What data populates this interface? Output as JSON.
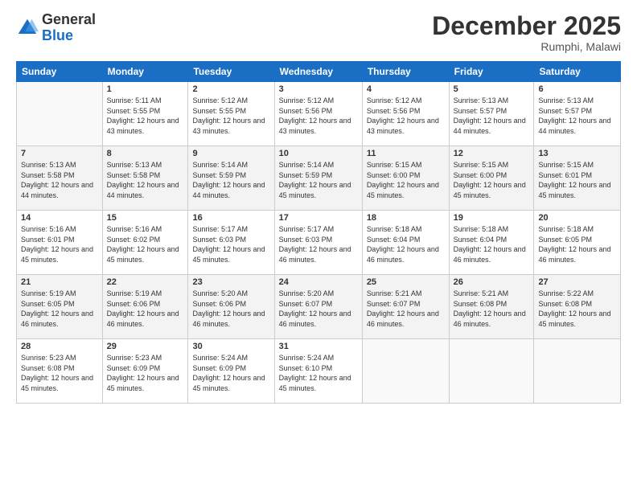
{
  "logo": {
    "general": "General",
    "blue": "Blue"
  },
  "header": {
    "month": "December 2025",
    "location": "Rumphi, Malawi"
  },
  "weekdays": [
    "Sunday",
    "Monday",
    "Tuesday",
    "Wednesday",
    "Thursday",
    "Friday",
    "Saturday"
  ],
  "weeks": [
    [
      {
        "day": "",
        "sunrise": "",
        "sunset": "",
        "daylight": ""
      },
      {
        "day": "1",
        "sunrise": "Sunrise: 5:11 AM",
        "sunset": "Sunset: 5:55 PM",
        "daylight": "Daylight: 12 hours and 43 minutes."
      },
      {
        "day": "2",
        "sunrise": "Sunrise: 5:12 AM",
        "sunset": "Sunset: 5:55 PM",
        "daylight": "Daylight: 12 hours and 43 minutes."
      },
      {
        "day": "3",
        "sunrise": "Sunrise: 5:12 AM",
        "sunset": "Sunset: 5:56 PM",
        "daylight": "Daylight: 12 hours and 43 minutes."
      },
      {
        "day": "4",
        "sunrise": "Sunrise: 5:12 AM",
        "sunset": "Sunset: 5:56 PM",
        "daylight": "Daylight: 12 hours and 43 minutes."
      },
      {
        "day": "5",
        "sunrise": "Sunrise: 5:13 AM",
        "sunset": "Sunset: 5:57 PM",
        "daylight": "Daylight: 12 hours and 44 minutes."
      },
      {
        "day": "6",
        "sunrise": "Sunrise: 5:13 AM",
        "sunset": "Sunset: 5:57 PM",
        "daylight": "Daylight: 12 hours and 44 minutes."
      }
    ],
    [
      {
        "day": "7",
        "sunrise": "Sunrise: 5:13 AM",
        "sunset": "Sunset: 5:58 PM",
        "daylight": "Daylight: 12 hours and 44 minutes."
      },
      {
        "day": "8",
        "sunrise": "Sunrise: 5:13 AM",
        "sunset": "Sunset: 5:58 PM",
        "daylight": "Daylight: 12 hours and 44 minutes."
      },
      {
        "day": "9",
        "sunrise": "Sunrise: 5:14 AM",
        "sunset": "Sunset: 5:59 PM",
        "daylight": "Daylight: 12 hours and 44 minutes."
      },
      {
        "day": "10",
        "sunrise": "Sunrise: 5:14 AM",
        "sunset": "Sunset: 5:59 PM",
        "daylight": "Daylight: 12 hours and 45 minutes."
      },
      {
        "day": "11",
        "sunrise": "Sunrise: 5:15 AM",
        "sunset": "Sunset: 6:00 PM",
        "daylight": "Daylight: 12 hours and 45 minutes."
      },
      {
        "day": "12",
        "sunrise": "Sunrise: 5:15 AM",
        "sunset": "Sunset: 6:00 PM",
        "daylight": "Daylight: 12 hours and 45 minutes."
      },
      {
        "day": "13",
        "sunrise": "Sunrise: 5:15 AM",
        "sunset": "Sunset: 6:01 PM",
        "daylight": "Daylight: 12 hours and 45 minutes."
      }
    ],
    [
      {
        "day": "14",
        "sunrise": "Sunrise: 5:16 AM",
        "sunset": "Sunset: 6:01 PM",
        "daylight": "Daylight: 12 hours and 45 minutes."
      },
      {
        "day": "15",
        "sunrise": "Sunrise: 5:16 AM",
        "sunset": "Sunset: 6:02 PM",
        "daylight": "Daylight: 12 hours and 45 minutes."
      },
      {
        "day": "16",
        "sunrise": "Sunrise: 5:17 AM",
        "sunset": "Sunset: 6:03 PM",
        "daylight": "Daylight: 12 hours and 45 minutes."
      },
      {
        "day": "17",
        "sunrise": "Sunrise: 5:17 AM",
        "sunset": "Sunset: 6:03 PM",
        "daylight": "Daylight: 12 hours and 46 minutes."
      },
      {
        "day": "18",
        "sunrise": "Sunrise: 5:18 AM",
        "sunset": "Sunset: 6:04 PM",
        "daylight": "Daylight: 12 hours and 46 minutes."
      },
      {
        "day": "19",
        "sunrise": "Sunrise: 5:18 AM",
        "sunset": "Sunset: 6:04 PM",
        "daylight": "Daylight: 12 hours and 46 minutes."
      },
      {
        "day": "20",
        "sunrise": "Sunrise: 5:18 AM",
        "sunset": "Sunset: 6:05 PM",
        "daylight": "Daylight: 12 hours and 46 minutes."
      }
    ],
    [
      {
        "day": "21",
        "sunrise": "Sunrise: 5:19 AM",
        "sunset": "Sunset: 6:05 PM",
        "daylight": "Daylight: 12 hours and 46 minutes."
      },
      {
        "day": "22",
        "sunrise": "Sunrise: 5:19 AM",
        "sunset": "Sunset: 6:06 PM",
        "daylight": "Daylight: 12 hours and 46 minutes."
      },
      {
        "day": "23",
        "sunrise": "Sunrise: 5:20 AM",
        "sunset": "Sunset: 6:06 PM",
        "daylight": "Daylight: 12 hours and 46 minutes."
      },
      {
        "day": "24",
        "sunrise": "Sunrise: 5:20 AM",
        "sunset": "Sunset: 6:07 PM",
        "daylight": "Daylight: 12 hours and 46 minutes."
      },
      {
        "day": "25",
        "sunrise": "Sunrise: 5:21 AM",
        "sunset": "Sunset: 6:07 PM",
        "daylight": "Daylight: 12 hours and 46 minutes."
      },
      {
        "day": "26",
        "sunrise": "Sunrise: 5:21 AM",
        "sunset": "Sunset: 6:08 PM",
        "daylight": "Daylight: 12 hours and 46 minutes."
      },
      {
        "day": "27",
        "sunrise": "Sunrise: 5:22 AM",
        "sunset": "Sunset: 6:08 PM",
        "daylight": "Daylight: 12 hours and 45 minutes."
      }
    ],
    [
      {
        "day": "28",
        "sunrise": "Sunrise: 5:23 AM",
        "sunset": "Sunset: 6:08 PM",
        "daylight": "Daylight: 12 hours and 45 minutes."
      },
      {
        "day": "29",
        "sunrise": "Sunrise: 5:23 AM",
        "sunset": "Sunset: 6:09 PM",
        "daylight": "Daylight: 12 hours and 45 minutes."
      },
      {
        "day": "30",
        "sunrise": "Sunrise: 5:24 AM",
        "sunset": "Sunset: 6:09 PM",
        "daylight": "Daylight: 12 hours and 45 minutes."
      },
      {
        "day": "31",
        "sunrise": "Sunrise: 5:24 AM",
        "sunset": "Sunset: 6:10 PM",
        "daylight": "Daylight: 12 hours and 45 minutes."
      },
      {
        "day": "",
        "sunrise": "",
        "sunset": "",
        "daylight": ""
      },
      {
        "day": "",
        "sunrise": "",
        "sunset": "",
        "daylight": ""
      },
      {
        "day": "",
        "sunrise": "",
        "sunset": "",
        "daylight": ""
      }
    ]
  ]
}
